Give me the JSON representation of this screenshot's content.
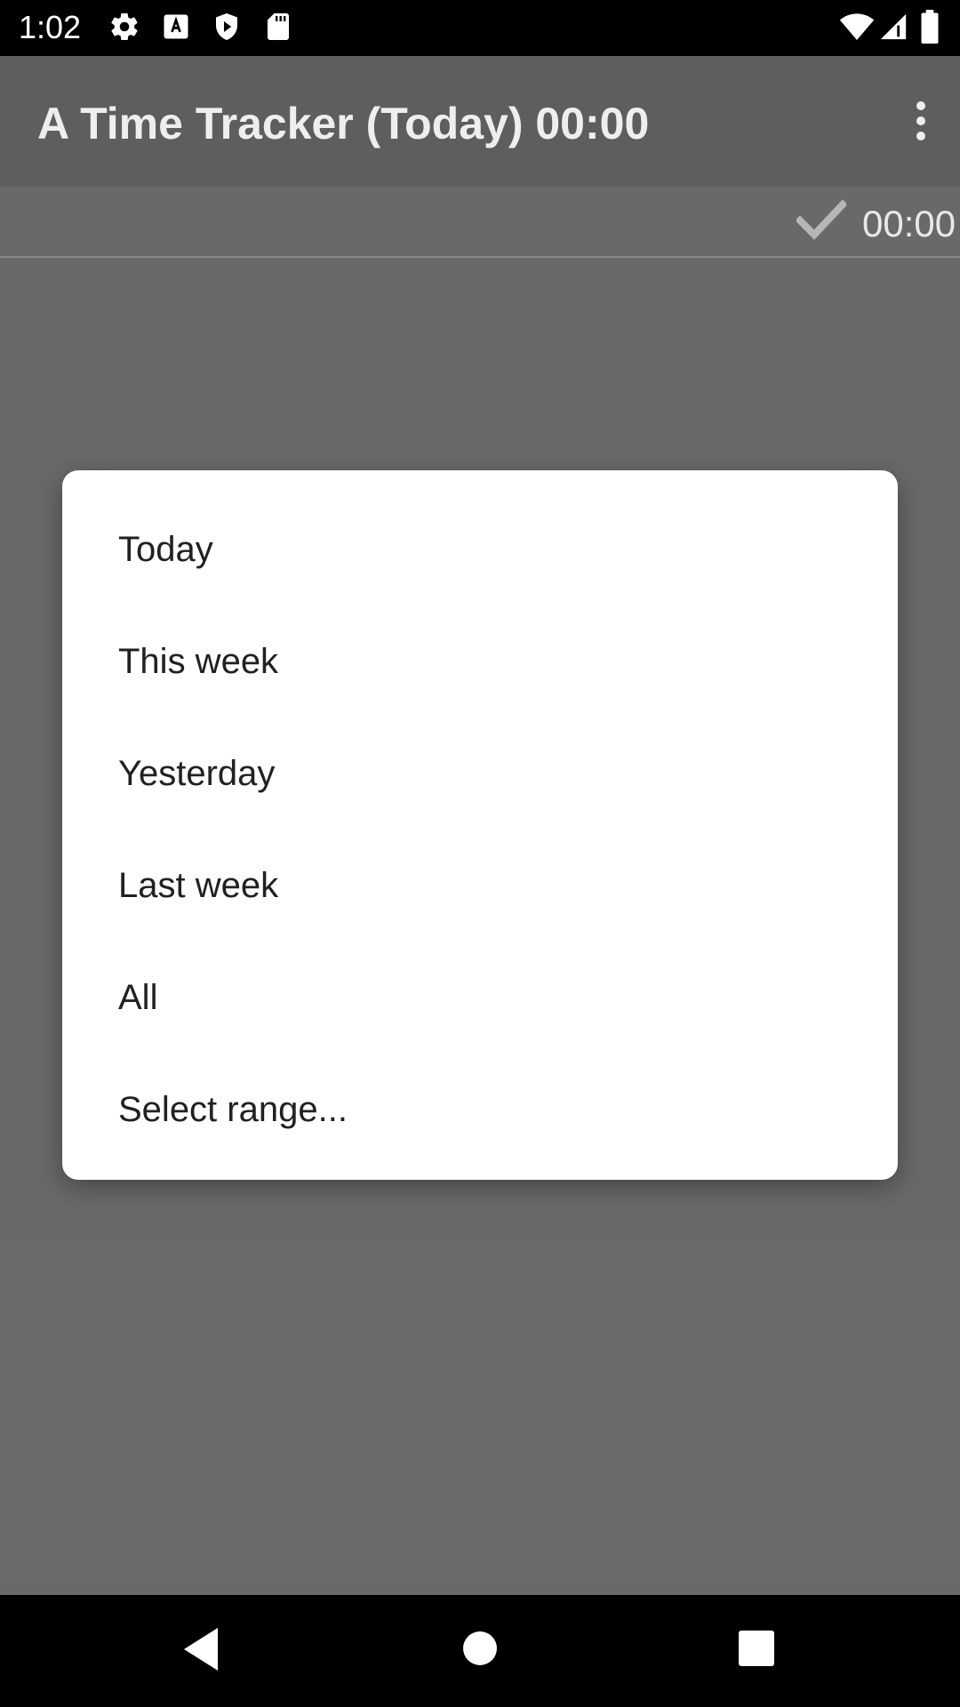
{
  "status_bar": {
    "time": "1:02",
    "left_icons": [
      "gear-icon",
      "a-keyboard-icon",
      "shield-play-icon",
      "sd-card-icon"
    ],
    "right_icons": [
      "wifi-icon",
      "cell-signal-icon",
      "battery-icon"
    ]
  },
  "app_bar": {
    "title": "A Time Tracker (Today) 00:00",
    "overflow_icon": "more-vert-icon"
  },
  "task_row": {
    "time": "00:00",
    "icon": "check-icon"
  },
  "range_dialog": {
    "options": [
      "Today",
      "This week",
      "Yesterday",
      "Last week",
      "All",
      "Select range..."
    ]
  },
  "nav_bar": {
    "buttons": [
      "back-icon",
      "home-icon",
      "recents-icon"
    ]
  }
}
